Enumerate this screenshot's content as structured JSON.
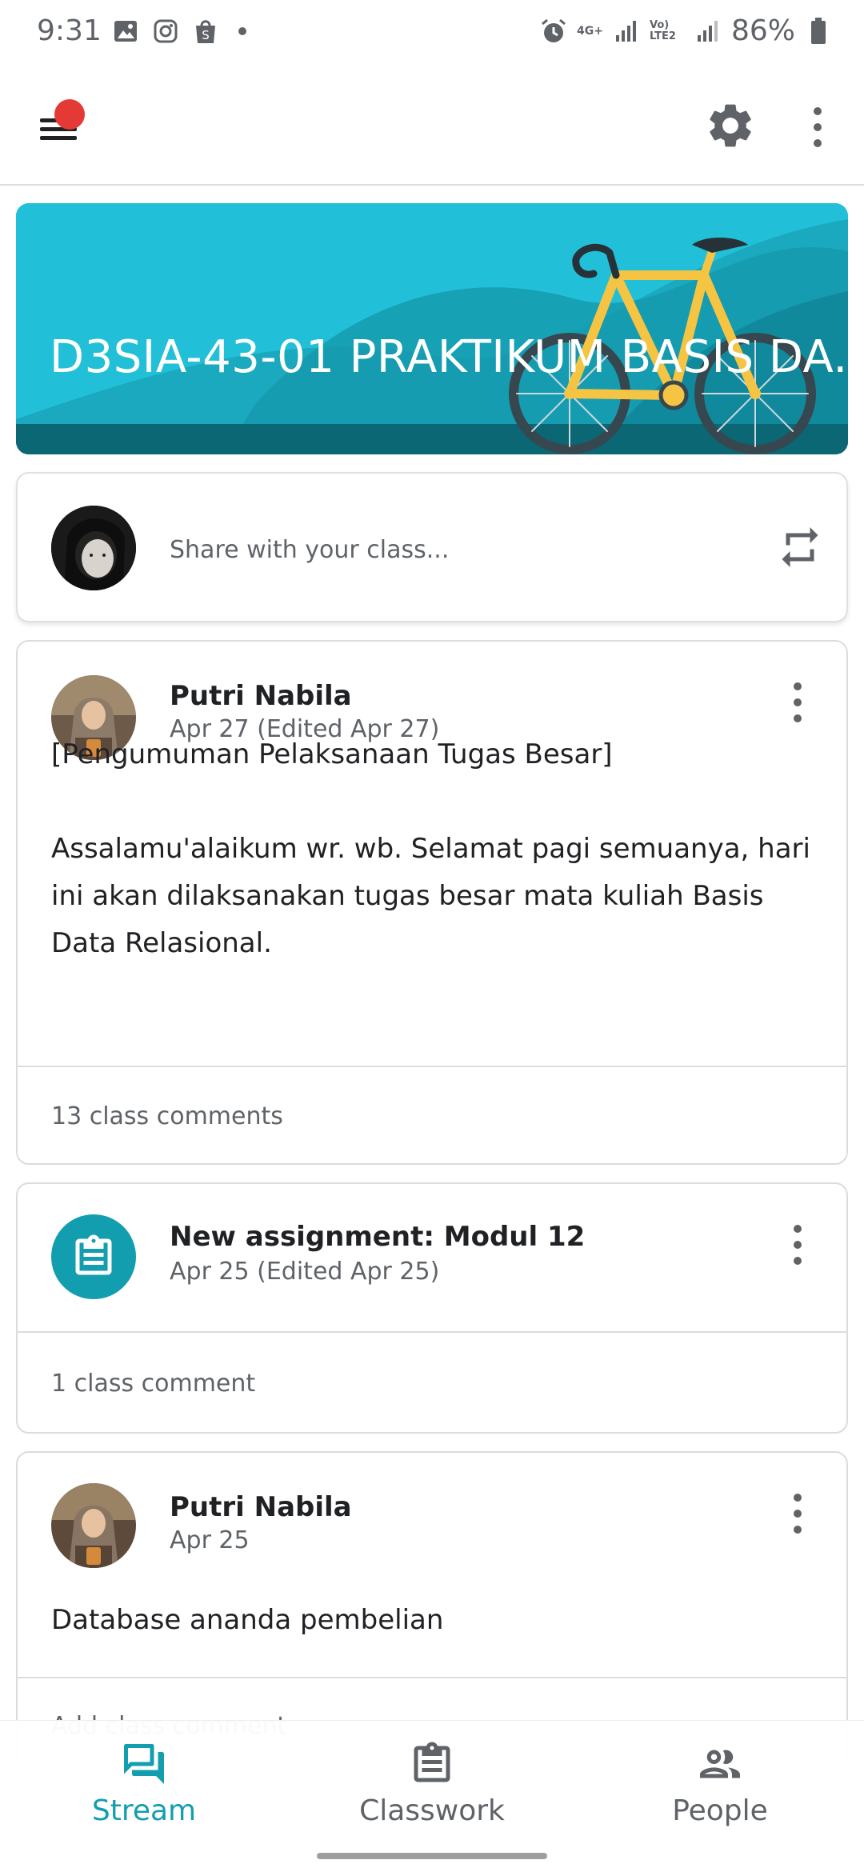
{
  "status_bar": {
    "time": "9:31",
    "battery": "86%",
    "network_4g": "4G+",
    "network_lte": "Vo) LTE2"
  },
  "app_bar": {
    "menu_icon": "hamburger-menu-icon",
    "settings_icon": "gear-icon",
    "more_icon": "more-vertical-icon"
  },
  "banner": {
    "title": "D3SIA-43-01 PRAKTIKUM BASIS DA...",
    "background_color": "#20c0d6"
  },
  "share": {
    "placeholder": "Share with your class..."
  },
  "posts": [
    {
      "author": "Putri Nabila",
      "date": "Apr 27 (Edited Apr 27)",
      "body_line1": "[Pengumuman Pelaksanaan Tugas Besar]",
      "body_line2": "Assalamu'alaikum wr. wb. Selamat pagi semuanya, hari ini akan dilaksanakan tugas besar mata kuliah Basis Data Relasional.",
      "comments": "13 class comments"
    },
    {
      "title": "New assignment: Modul 12",
      "date": "Apr 25 (Edited Apr 25)",
      "comments": "1 class comment"
    },
    {
      "author": "Putri Nabila",
      "date": "Apr 25",
      "body": "Database ananda pembelian",
      "comments": "Add class comment"
    }
  ],
  "bottom_nav": {
    "items": [
      {
        "label": "Stream",
        "active": true
      },
      {
        "label": "Classwork",
        "active": false
      },
      {
        "label": "People",
        "active": false
      }
    ],
    "accent_color": "#129eaf"
  }
}
